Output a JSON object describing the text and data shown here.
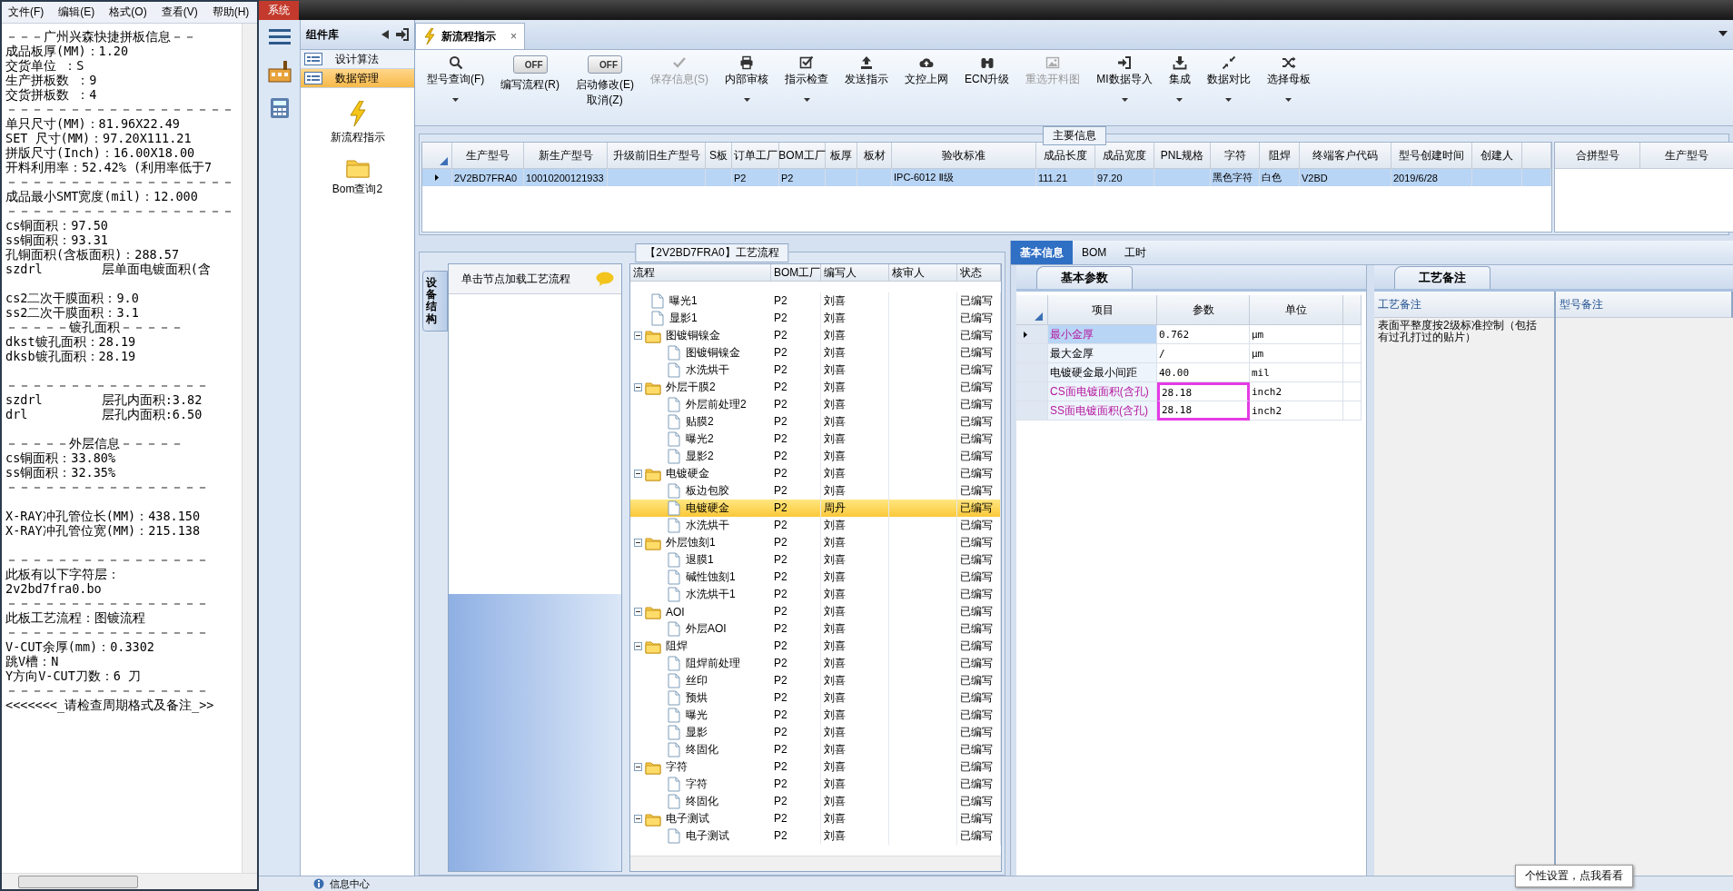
{
  "notepad": {
    "menu": [
      "文件(F)",
      "编辑(E)",
      "格式(O)",
      "查看(V)",
      "帮助(H)"
    ],
    "blocks": [
      [
        "－－－广州兴森快捷拼板信息－－",
        "成品板厚(MM)：1.20",
        "交货单位 ：S",
        "生产拼板数 ：9",
        "交货拼板数 ：4",
        "－－－－－－－－－－－－－－－－－－",
        "单只尺寸(MM)：81.96X22.49",
        "SET 尺寸(MM)：97.20X111.21",
        "拼版尺寸(Inch)：16.00X18.00",
        "开料利用率：52.42% (利用率低于7",
        "－－－－－－－－－－－－－－－－－－",
        "成品最小SMT宽度(mil)：12.000",
        "－－－－－－－－－－－－－－－－－－",
        "cs铜面积：97.50",
        "ss铜面积：93.31",
        "孔铜面积(含板面积)：288.57",
        "szdrl        层单面电镀面积(含"
      ],
      [
        "cs2二次干膜面积：9.0",
        "ss2二次干膜面积：3.1",
        "－－－－－镀孔面积－－－－－",
        "dkst镀孔面积：28.19",
        "dksb镀孔面积：28.19"
      ],
      [
        "－－－－－－－－－－－－－－－－",
        "szdrl        层孔内面积:3.82",
        "drl          层孔内面积:6.50"
      ],
      [
        "－－－－－外层信息－－－－－",
        "cs铜面积：33.80%",
        "ss铜面积：32.35%",
        "－－－－－－－－－－－－－－－－"
      ],
      [
        "X-RAY冲孔管位长(MM)：438.150",
        "X-RAY冲孔管位宽(MM)：215.138"
      ],
      [
        "－－－－－－－－－－－－－－－－",
        "此板有以下字符层：",
        "2v2bd7fra0.bo",
        "－－－－－－－－－－－－－－－－",
        "此板工艺流程：图镀流程",
        "－－－－－－－－－－－－－－－－",
        "V-CUT余厚(mm)：0.3302",
        "跳V槽：N",
        "Y方向V-CUT刀数：6 刀",
        "－－－－－－－－－－－－－－－－",
        "<<<<<<<_请检查周期格式及备注_>>"
      ]
    ]
  },
  "system_tab": "系统",
  "component_panel": {
    "title": "组件库",
    "items": [
      {
        "label": "设计算法",
        "selected": false
      },
      {
        "label": "数据管理",
        "selected": true
      }
    ],
    "tools": [
      {
        "label": "新流程指示",
        "kind": "lightning"
      },
      {
        "label": "Bom查询2",
        "kind": "folder"
      }
    ]
  },
  "document_tab": {
    "label": "新流程指示",
    "close_glyph": "×"
  },
  "toolbar": [
    {
      "kind": "button",
      "label": "型号查询(F)",
      "dropdown": true,
      "disabled": false
    },
    {
      "kind": "toggle",
      "label": "编写流程(R)",
      "switch_text": "OFF",
      "on": false
    },
    {
      "kind": "toggle",
      "label": "启动修改(E)",
      "sublabel": "取消(Z)",
      "switch_text": "OFF",
      "on": false
    },
    {
      "kind": "button",
      "label": "保存信息(S)",
      "dropdown": false,
      "disabled": true
    },
    {
      "kind": "button",
      "label": "内部审核",
      "dropdown": true,
      "disabled": false
    },
    {
      "kind": "button",
      "label": "指示检查",
      "dropdown": true,
      "disabled": false
    },
    {
      "kind": "button",
      "label": "发送指示",
      "dropdown": false,
      "disabled": false
    },
    {
      "kind": "button",
      "label": "文控上网",
      "dropdown": false,
      "disabled": false
    },
    {
      "kind": "button",
      "label": "ECN升级",
      "dropdown": false,
      "disabled": false
    },
    {
      "kind": "button",
      "label": "重选开料图",
      "dropdown": false,
      "disabled": true
    },
    {
      "kind": "button",
      "label": "MI数据导入",
      "dropdown": true,
      "disabled": false
    },
    {
      "kind": "button",
      "label": "集成",
      "dropdown": true,
      "disabled": false
    },
    {
      "kind": "button",
      "label": "数据对比",
      "dropdown": true,
      "disabled": false
    },
    {
      "kind": "button",
      "label": "选择母板",
      "dropdown": true,
      "disabled": false
    }
  ],
  "main_info": {
    "title": "主要信息",
    "columns": [
      "生产型号",
      "新生产型号",
      "升级前旧生产型号",
      "S板",
      "订单工厂",
      "BOM工厂",
      "板厚",
      "板材",
      "验收标准",
      "成品长度",
      "成品宽度",
      "PNL规格",
      "字符",
      "阻焊",
      "终端客户代码",
      "型号创建时间",
      "创建人"
    ],
    "rows": [
      {
        "selected": true,
        "cells": [
          "2V2BD7FRA0",
          "10010200121933",
          null,
          null,
          "P2",
          "P2",
          null,
          null,
          "IPC-6012 Ⅱ级",
          "111.21",
          "97.20",
          null,
          "黑色字符",
          "白色",
          "V2BD",
          "2019/6/28",
          null
        ]
      }
    ]
  },
  "merge_table": {
    "columns": [
      "合拼型号",
      "生产型号"
    ]
  },
  "flow_panel": {
    "title": "【2V2BD7FRA0】工艺流程",
    "side_tab": "设备结构",
    "hint": "单击节点加载工艺流程",
    "columns": [
      "流程",
      "BOM工厂",
      "编写人",
      "核审人",
      "状态"
    ],
    "tree": [
      {
        "kind": "step",
        "label": "曝光1",
        "bom": "P2",
        "writer": "刘喜",
        "status": "已编写",
        "selected": false
      },
      {
        "kind": "step",
        "label": "显影1",
        "bom": "P2",
        "writer": "刘喜",
        "status": "已编写",
        "selected": false
      },
      {
        "kind": "group",
        "label": "图镀铜镍金",
        "bom": "P2",
        "writer": "刘喜",
        "status": "已编写",
        "selected": false,
        "expanded": true,
        "children": [
          {
            "kind": "step",
            "label": "图镀铜镍金",
            "bom": "P2",
            "writer": "刘喜",
            "status": "已编写",
            "selected": false
          },
          {
            "kind": "step",
            "label": "水洗烘干",
            "bom": "P2",
            "writer": "刘喜",
            "status": "已编写",
            "selected": false
          }
        ]
      },
      {
        "kind": "group",
        "label": "外层干膜2",
        "bom": "P2",
        "writer": "刘喜",
        "status": "已编写",
        "selected": false,
        "expanded": true,
        "children": [
          {
            "kind": "step",
            "label": "外层前处理2",
            "bom": "P2",
            "writer": "刘喜",
            "status": "已编写",
            "selected": false
          },
          {
            "kind": "step",
            "label": "贴膜2",
            "bom": "P2",
            "writer": "刘喜",
            "status": "已编写",
            "selected": false
          },
          {
            "kind": "step",
            "label": "曝光2",
            "bom": "P2",
            "writer": "刘喜",
            "status": "已编写",
            "selected": false
          },
          {
            "kind": "step",
            "label": "显影2",
            "bom": "P2",
            "writer": "刘喜",
            "status": "已编写",
            "selected": false
          }
        ]
      },
      {
        "kind": "group",
        "label": "电镀硬金",
        "bom": "P2",
        "writer": "刘喜",
        "status": "已编写",
        "selected": false,
        "expanded": true,
        "children": [
          {
            "kind": "step",
            "label": "板边包胶",
            "bom": "P2",
            "writer": "刘喜",
            "status": "已编写",
            "selected": false
          },
          {
            "kind": "step",
            "label": "电镀硬金",
            "bom": "P2",
            "writer": "周丹",
            "status": "已编写",
            "selected": true
          },
          {
            "kind": "step",
            "label": "水洗烘干",
            "bom": "P2",
            "writer": "刘喜",
            "status": "已编写",
            "selected": false
          }
        ]
      },
      {
        "kind": "group",
        "label": "外层蚀刻1",
        "bom": "P2",
        "writer": "刘喜",
        "status": "已编写",
        "selected": false,
        "expanded": true,
        "children": [
          {
            "kind": "step",
            "label": "退膜1",
            "bom": "P2",
            "writer": "刘喜",
            "status": "已编写",
            "selected": false
          },
          {
            "kind": "step",
            "label": "碱性蚀刻1",
            "bom": "P2",
            "writer": "刘喜",
            "status": "已编写",
            "selected": false
          },
          {
            "kind": "step",
            "label": "水洗烘干1",
            "bom": "P2",
            "writer": "刘喜",
            "status": "已编写",
            "selected": false
          }
        ]
      },
      {
        "kind": "group",
        "label": "AOI",
        "bom": "P2",
        "writer": "刘喜",
        "status": "已编写",
        "selected": false,
        "expanded": true,
        "children": [
          {
            "kind": "step",
            "label": "外层AOI",
            "bom": "P2",
            "writer": "刘喜",
            "status": "已编写",
            "selected": false
          }
        ]
      },
      {
        "kind": "group",
        "label": "阻焊",
        "bom": "P2",
        "writer": "刘喜",
        "status": "已编写",
        "selected": false,
        "expanded": true,
        "children": [
          {
            "kind": "step",
            "label": "阻焊前处理",
            "bom": "P2",
            "writer": "刘喜",
            "status": "已编写",
            "selected": false
          },
          {
            "kind": "step",
            "label": "丝印",
            "bom": "P2",
            "writer": "刘喜",
            "status": "已编写",
            "selected": false
          },
          {
            "kind": "step",
            "label": "预烘",
            "bom": "P2",
            "writer": "刘喜",
            "status": "已编写",
            "selected": false
          },
          {
            "kind": "step",
            "label": "曝光",
            "bom": "P2",
            "writer": "刘喜",
            "status": "已编写",
            "selected": false
          },
          {
            "kind": "step",
            "label": "显影",
            "bom": "P2",
            "writer": "刘喜",
            "status": "已编写",
            "selected": false
          },
          {
            "kind": "step",
            "label": "终固化",
            "bom": "P2",
            "writer": "刘喜",
            "status": "已编写",
            "selected": false
          }
        ]
      },
      {
        "kind": "group",
        "label": "字符",
        "bom": "P2",
        "writer": "刘喜",
        "status": "已编写",
        "selected": false,
        "expanded": true,
        "children": [
          {
            "kind": "step",
            "label": "字符",
            "bom": "P2",
            "writer": "刘喜",
            "status": "已编写",
            "selected": false
          },
          {
            "kind": "step",
            "label": "终固化",
            "bom": "P2",
            "writer": "刘喜",
            "status": "已编写",
            "selected": false
          }
        ]
      },
      {
        "kind": "group",
        "label": "电子测试",
        "bom": "P2",
        "writer": "刘喜",
        "status": "已编写",
        "selected": false,
        "expanded": true,
        "children": [
          {
            "kind": "step",
            "label": "电子测试",
            "bom": "P2",
            "writer": "刘喜",
            "status": "已编写",
            "selected": false
          }
        ]
      }
    ]
  },
  "info_panel": {
    "tabs": [
      {
        "label": "基本信息",
        "selected": true
      },
      {
        "label": "BOM",
        "selected": false
      },
      {
        "label": "工时",
        "selected": false
      }
    ],
    "subtab": "基本参数",
    "columns": [
      "项目",
      "参数",
      "单位"
    ],
    "rows": [
      {
        "item": "最小金厚",
        "value": "0.762",
        "unit": "μm",
        "selected": true,
        "emphasis": true,
        "outlined": false
      },
      {
        "item": "最大金厚",
        "value": "/",
        "unit": "μm",
        "selected": false,
        "emphasis": false,
        "outlined": false
      },
      {
        "item": "电镀硬金最小间距",
        "value": "40.00",
        "unit": "mil",
        "selected": false,
        "emphasis": false,
        "outlined": false
      },
      {
        "item": "CS面电镀面积(含孔)",
        "value": "28.18",
        "unit": "inch2",
        "selected": false,
        "emphasis": true,
        "outlined": true
      },
      {
        "item": "SS面电镀面积(含孔)",
        "value": "28.18",
        "unit": "inch2",
        "selected": false,
        "emphasis": true,
        "outlined": true
      }
    ]
  },
  "notes_panel": {
    "tab": "工艺备注",
    "columns": [
      "工艺备注",
      "型号备注"
    ],
    "process_note": "表面平整度按2级标准控制（包括有过孔打过的贴片）"
  },
  "status_bar": {
    "items": [
      "信息中心"
    ]
  },
  "tooltip": "个性设置，点我看看"
}
